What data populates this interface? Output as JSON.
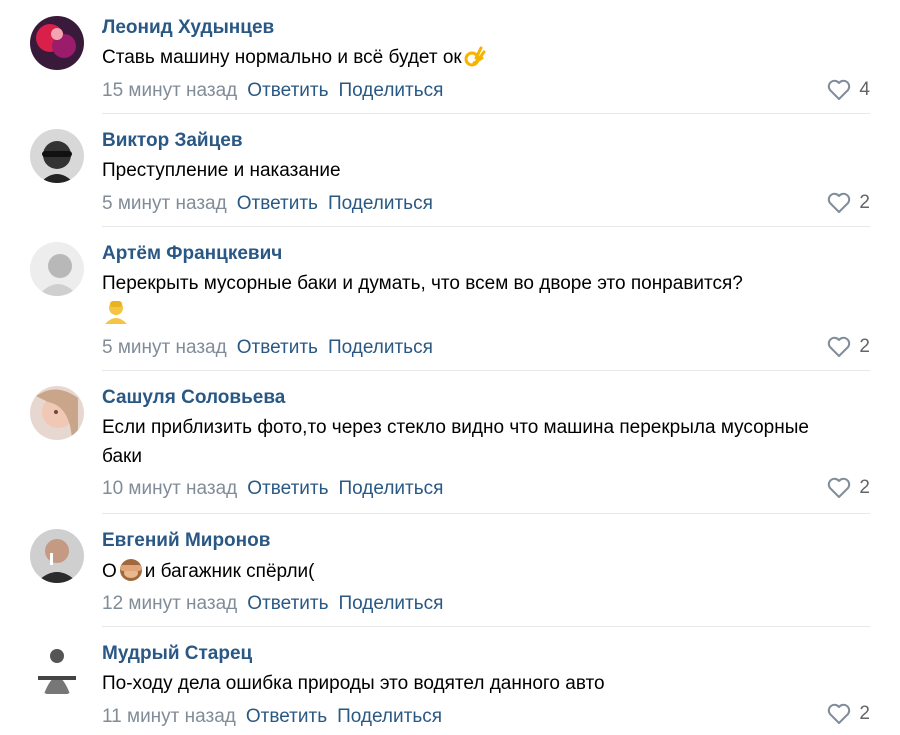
{
  "comments": [
    {
      "author": "Леонид Худынцев",
      "text": "Ставь машину нормально и всё будет ок",
      "emoji": "ok-hand",
      "time": "15 минут назад",
      "reply": "Ответить",
      "share": "Поделиться",
      "likes": "4"
    },
    {
      "author": "Виктор Зайцев",
      "text": "Преступление и наказание",
      "time": "5 минут назад",
      "reply": "Ответить",
      "share": "Поделиться",
      "likes": "2"
    },
    {
      "author": "Артём Францкевич",
      "text": "Перекрыть мусорные баки и думать, что всем во дворе это понравится?",
      "emoji": "person-blond",
      "time": "5 минут назад",
      "reply": "Ответить",
      "share": "Поделиться",
      "likes": "2"
    },
    {
      "author": "Сашуля Соловьева",
      "text": "Если приблизить фото,то через стекло видно что машина перекрыла мусорные баки",
      "time": "10 минут назад",
      "reply": "Ответить",
      "share": "Поделиться",
      "likes": "2"
    },
    {
      "author": "Евгений Миронов",
      "text_before": "О",
      "text_after": "и багажник спёрли(",
      "emoji": "see-no-evil-monkey",
      "time": "12 минут назад",
      "reply": "Ответить",
      "share": "Поделиться"
    },
    {
      "author": "Мудрый Старец",
      "text": "По-ходу дела ошибка природы это водятел данного авто",
      "time": "11 минут назад",
      "reply": "Ответить",
      "share": "Поделиться",
      "likes": "2"
    }
  ],
  "colors": {
    "author": "#2a5885",
    "link": "#2a5885",
    "time": "#818c99",
    "separator": "#e7e8ec"
  },
  "icons": {
    "like": "heart-outline-icon"
  }
}
